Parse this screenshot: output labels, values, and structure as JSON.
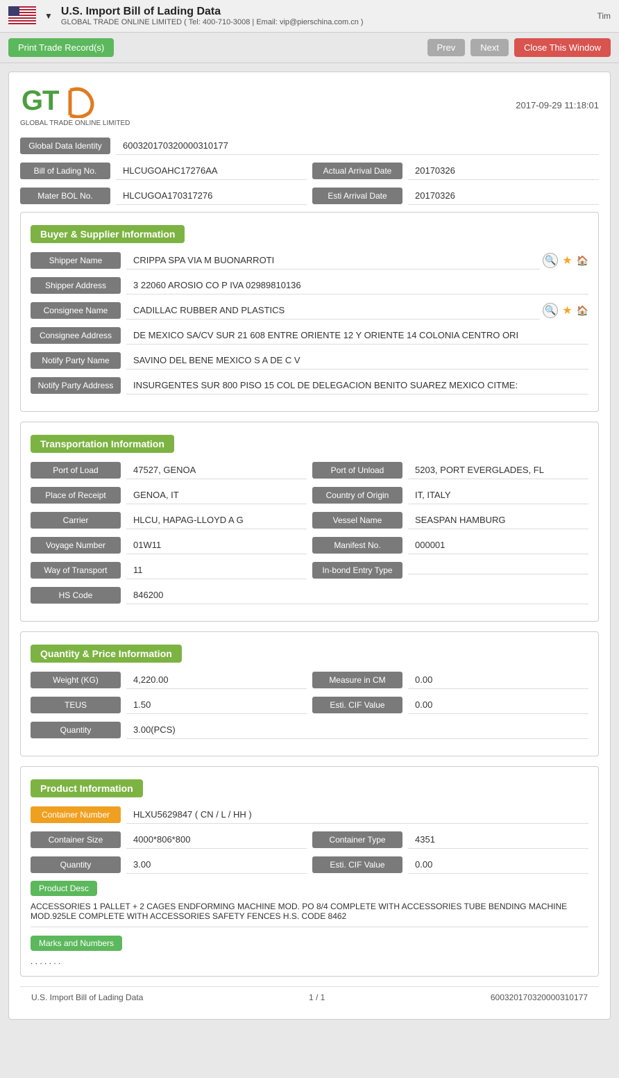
{
  "topBar": {
    "title": "U.S. Import Bill of Lading Data",
    "titleArrow": "▼",
    "subtitle": "GLOBAL TRADE ONLINE LIMITED ( Tel: 400-710-3008 | Email: vip@pierschina.com.cn )",
    "rightText": "Tim"
  },
  "toolbar": {
    "printLabel": "Print Trade Record(s)",
    "prevLabel": "Prev",
    "nextLabel": "Next",
    "closeLabel": "Close This Window"
  },
  "record": {
    "date": "2017-09-29 11:18:01",
    "logoSubtitle": "GLOBAL TRADE ONLINE LIMITED",
    "globalDataIdentity": {
      "label": "Global Data Identity",
      "value": "600320170320000310177"
    },
    "billOfLading": {
      "label": "Bill of Lading No.",
      "value": "HLCUGOAHC17276AA"
    },
    "actualArrivalDate": {
      "label": "Actual Arrival Date",
      "value": "20170326"
    },
    "masterBOL": {
      "label": "Mater BOL No.",
      "value": "HLCUGOA170317276"
    },
    "estiArrivalDate": {
      "label": "Esti Arrival Date",
      "value": "20170326"
    }
  },
  "buyerSupplier": {
    "sectionTitle": "Buyer & Supplier Information",
    "shipperName": {
      "label": "Shipper Name",
      "value": "CRIPPA SPA VIA M BUONARROTI"
    },
    "shipperAddress": {
      "label": "Shipper Address",
      "value": "3 22060 AROSIO CO P IVA 02989810136"
    },
    "consigneeName": {
      "label": "Consignee Name",
      "value": "CADILLAC RUBBER AND PLASTICS"
    },
    "consigneeAddress": {
      "label": "Consignee Address",
      "value": "DE MEXICO SA/CV SUR 21 608 ENTRE ORIENTE 12 Y ORIENTE 14 COLONIA CENTRO ORI"
    },
    "notifyPartyName": {
      "label": "Notify Party Name",
      "value": "SAVINO DEL BENE MEXICO S A DE C V"
    },
    "notifyPartyAddress": {
      "label": "Notify Party Address",
      "value": "INSURGENTES SUR 800 PISO 15 COL DE DELEGACION BENITO SUAREZ MEXICO CITME:"
    }
  },
  "transportation": {
    "sectionTitle": "Transportation Information",
    "portOfLoad": {
      "label": "Port of Load",
      "value": "47527, GENOA"
    },
    "portOfUnload": {
      "label": "Port of Unload",
      "value": "5203, PORT EVERGLADES, FL"
    },
    "placeOfReceipt": {
      "label": "Place of Receipt",
      "value": "GENOA, IT"
    },
    "countryOfOrigin": {
      "label": "Country of Origin",
      "value": "IT, ITALY"
    },
    "carrier": {
      "label": "Carrier",
      "value": "HLCU, HAPAG-LLOYD A G"
    },
    "vesselName": {
      "label": "Vessel Name",
      "value": "SEASPAN HAMBURG"
    },
    "voyageNumber": {
      "label": "Voyage Number",
      "value": "01W11"
    },
    "manifestNo": {
      "label": "Manifest No.",
      "value": "000001"
    },
    "wayOfTransport": {
      "label": "Way of Transport",
      "value": "11"
    },
    "inBondEntryType": {
      "label": "In-bond Entry Type",
      "value": ""
    },
    "hsCode": {
      "label": "HS Code",
      "value": "846200"
    }
  },
  "quantityPrice": {
    "sectionTitle": "Quantity & Price Information",
    "weightKG": {
      "label": "Weight (KG)",
      "value": "4,220.00"
    },
    "measureInCM": {
      "label": "Measure in CM",
      "value": "0.00"
    },
    "teus": {
      "label": "TEUS",
      "value": "1.50"
    },
    "estiCIFValue": {
      "label": "Esti. CIF Value",
      "value": "0.00"
    },
    "quantity": {
      "label": "Quantity",
      "value": "3.00(PCS)"
    }
  },
  "productInfo": {
    "sectionTitle": "Product Information",
    "containerNumber": {
      "label": "Container Number",
      "value": "HLXU5629847 ( CN / L / HH )"
    },
    "containerSize": {
      "label": "Container Size",
      "value": "4000*806*800"
    },
    "containerType": {
      "label": "Container Type",
      "value": "4351"
    },
    "quantity": {
      "label": "Quantity",
      "value": "3.00"
    },
    "estiCIFValue": {
      "label": "Esti. CIF Value",
      "value": "0.00"
    },
    "productDescLabel": "Product Desc",
    "productDescText": "ACCESSORIES 1 PALLET + 2 CAGES ENDFORMING MACHINE MOD. PO 8/4 COMPLETE WITH ACCESSORIES TUBE BENDING MACHINE MOD.925LE COMPLETE WITH ACCESSORIES SAFETY FENCES H.S. CODE 8462",
    "marksAndNumbersLabel": "Marks and Numbers",
    "marksAndNumbersText": ". . . . . . ."
  },
  "footer": {
    "leftText": "U.S. Import Bill of Lading Data",
    "pageText": "1 / 1",
    "rightText": "600320170320000310177"
  }
}
